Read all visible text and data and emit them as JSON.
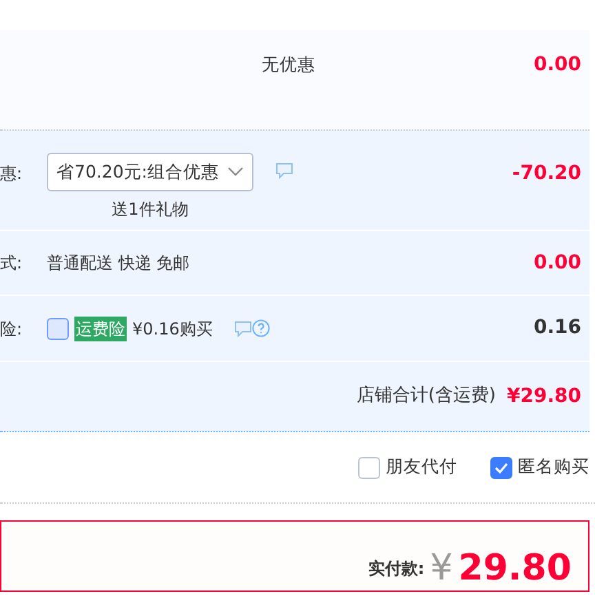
{
  "no_discount_row": {
    "label": "无优惠",
    "amount": "0.00"
  },
  "discount_row": {
    "label": "惠:",
    "select_value": "省70.20元:组合优惠",
    "gift_note": "送1件礼物",
    "amount": "-70.20"
  },
  "delivery_row": {
    "label": "式:",
    "method": "普通配送 快递 免邮",
    "amount": "0.00"
  },
  "insurance_row": {
    "label": "险:",
    "checked": false,
    "tag": "运费险",
    "price_text": "¥0.16购买",
    "amount": "0.16"
  },
  "shop_total": {
    "label": "店铺合计(含运费)",
    "amount": "¥29.80"
  },
  "options": [
    {
      "label": "朋友代付",
      "checked": false
    },
    {
      "label": "匿名购买",
      "checked": true
    }
  ],
  "payment": {
    "label": "实付款:",
    "currency": "¥",
    "amount": "29.80"
  }
}
